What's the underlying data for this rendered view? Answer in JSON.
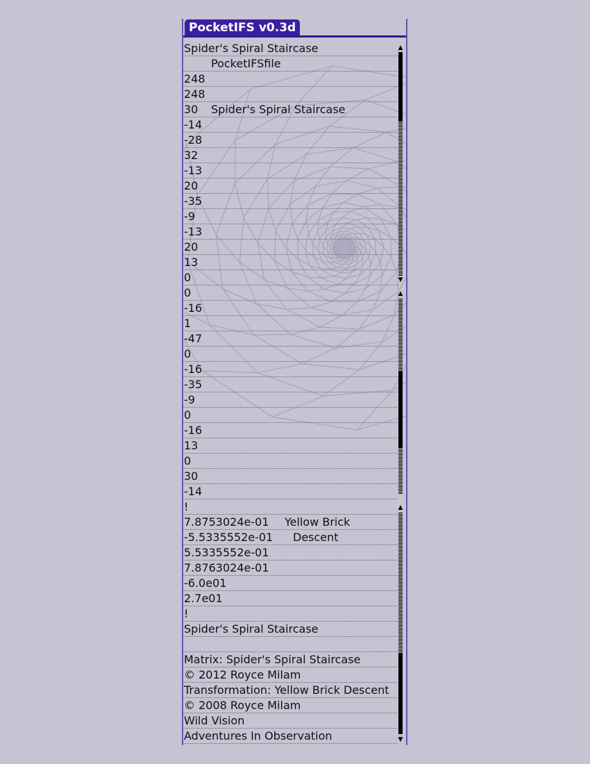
{
  "app": {
    "title": "PocketIFS v0.3d"
  },
  "header_fields": [
    {
      "c1": "Spider's Spiral Staircase",
      "c2": ""
    },
    {
      "c1": "",
      "c2": "PocketIFSfile"
    },
    {
      "c1": "248",
      "c2": ""
    },
    {
      "c1": "248",
      "c2": ""
    },
    {
      "c1": "30",
      "c2": "Spider's Spiral Staircase"
    },
    {
      "c1": "-14",
      "c2": ""
    },
    {
      "c1": "-28",
      "c2": ""
    },
    {
      "c1": "32",
      "c2": ""
    },
    {
      "c1": "-13",
      "c2": ""
    },
    {
      "c1": "20",
      "c2": ""
    },
    {
      "c1": "-35",
      "c2": ""
    },
    {
      "c1": "-9",
      "c2": ""
    },
    {
      "c1": "-13",
      "c2": ""
    },
    {
      "c1": "20",
      "c2": ""
    },
    {
      "c1": "13",
      "c2": ""
    },
    {
      "c1": "0",
      "c2": ""
    }
  ],
  "matrix_values": [
    "0",
    "-16",
    "1",
    "-47",
    "0",
    "-16",
    "-35",
    "-9",
    "0",
    "-16",
    "13",
    "0",
    "30",
    "-14"
  ],
  "transform_fields": [
    {
      "c1": "!",
      "c2": ""
    },
    {
      "c1": "7.8753024e-01",
      "c2": "Yellow Brick"
    },
    {
      "c1": "-5.5335552e-01",
      "c2": "Descent"
    },
    {
      "c1": "5.5335552e-01",
      "c2": ""
    },
    {
      "c1": "7.8763024e-01",
      "c2": ""
    },
    {
      "c1": "-6.0e01",
      "c2": ""
    },
    {
      "c1": "2.7e01",
      "c2": ""
    },
    {
      "c1": "!",
      "c2": ""
    },
    {
      "c1": "Spider's Spiral Staircase",
      "c2": ""
    },
    {
      "c1": "",
      "c2": ""
    },
    {
      "c1": "Matrix:  Spider's Spiral Staircase",
      "c2": ""
    },
    {
      "c1": "© 2012  Royce Milam",
      "c2": ""
    },
    {
      "c1": "Transformation: Yellow Brick Descent",
      "c2": ""
    },
    {
      "c1": "© 2008  Royce Milam",
      "c2": ""
    },
    {
      "c1": "Wild Vision",
      "c2": ""
    },
    {
      "c1": "Adventures In Observation",
      "c2": ""
    }
  ],
  "icons": {
    "scroll_up": "up-arrow-icon",
    "scroll_down": "down-arrow-icon"
  },
  "colors": {
    "background": "#c6c3d3",
    "title_tab": "#3a1fa0",
    "frame_border": "#5a5ab4"
  }
}
